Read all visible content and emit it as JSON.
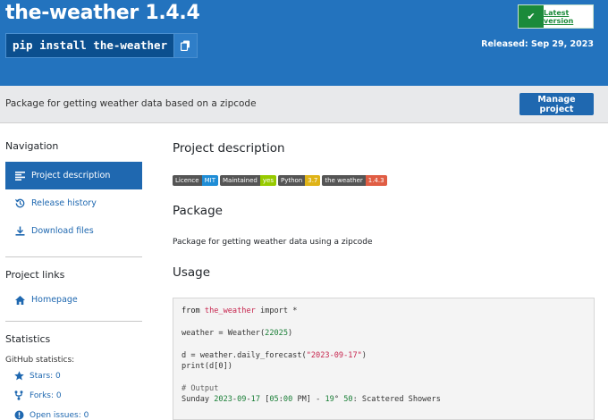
{
  "header": {
    "package_title": "the-weather 1.4.4",
    "pip_command": "pip install the-weather",
    "latest_version_label": "Latest version",
    "released_label": "Released: Sep 29, 2023",
    "color_banner": "#2373be"
  },
  "summary": {
    "text": "Package for getting weather data based on a zipcode",
    "manage_label": "Manage project"
  },
  "sidebar": {
    "navigation_heading": "Navigation",
    "nav_items": [
      {
        "label": "Project description",
        "icon": "align-left-icon",
        "active": true
      },
      {
        "label": "Release history",
        "icon": "history-icon",
        "active": false
      },
      {
        "label": "Download files",
        "icon": "download-icon",
        "active": false
      }
    ],
    "links_heading": "Project links",
    "homepage_label": "Homepage",
    "statistics_heading": "Statistics",
    "github_stats_label": "GitHub statistics:",
    "stats": [
      {
        "label": "Stars: 0",
        "icon": "star-icon"
      },
      {
        "label": "Forks: 0",
        "icon": "fork-icon"
      },
      {
        "label": "Open issues: 0",
        "icon": "alert-icon"
      }
    ]
  },
  "main": {
    "project_description_heading": "Project description",
    "badges": [
      {
        "left": "Licence",
        "right": "MIT",
        "color": "#1f8dd6"
      },
      {
        "left": "Maintained",
        "right": "yes",
        "color": "#97ca00"
      },
      {
        "left": "Python",
        "right": "3.7",
        "color": "#dfb317"
      },
      {
        "left": "the weather",
        "right": "1.4.3",
        "color": "#e05d44"
      }
    ],
    "package_heading": "Package",
    "package_text": "Package for getting weather data using a zipcode",
    "usage_heading": "Usage",
    "code": {
      "l1_from": "from",
      "l1_module": "the_weather",
      "l1_rest": " import *",
      "l2_a": "weather = Weather(",
      "l2_num": "22025",
      "l2_b": ")",
      "l3_a": "d = weather.daily_forecast(",
      "l3_str": "\"2023-09-17\"",
      "l3_b": ")",
      "l4": "print(d[0])",
      "l5": "# Output",
      "l6_a": "Sunday ",
      "l6_num1": "2023",
      "l6_b": "-",
      "l6_num2": "09",
      "l6_c": "-",
      "l6_num3": "17",
      "l6_d": " [",
      "l6_num4": "05",
      "l6_e": ":",
      "l6_num5": "00",
      "l6_f": " PM] - ",
      "l6_num6": "19",
      "l6_g": "° ",
      "l6_num7": "50",
      "l6_h": ": Scattered Showers"
    }
  }
}
